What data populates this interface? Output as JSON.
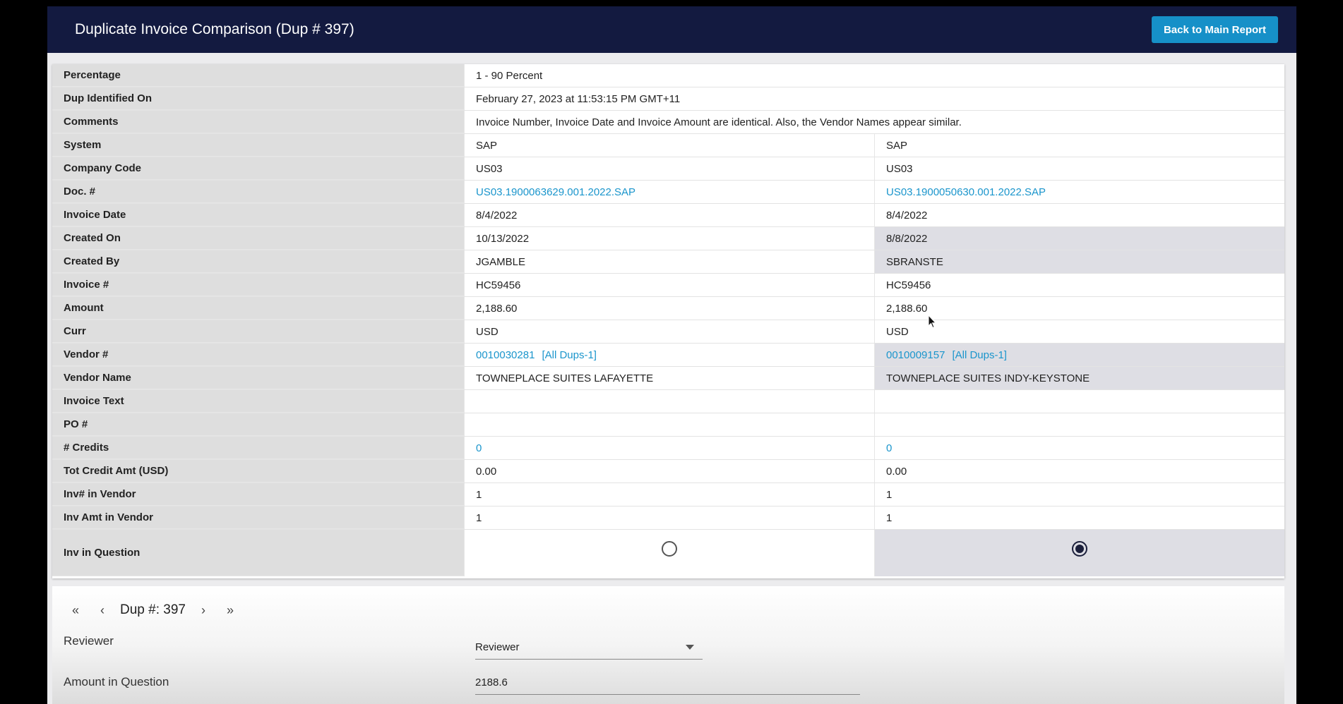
{
  "header": {
    "title": "Duplicate Invoice Comparison (Dup # 397)",
    "back_label": "Back to Main Report"
  },
  "rows": {
    "percentage": {
      "label": "Percentage",
      "value": "1 - 90 Percent"
    },
    "dup_identified": {
      "label": "Dup Identified On",
      "value": "February 27, 2023 at 11:53:15 PM GMT+11"
    },
    "comments": {
      "label": "Comments",
      "value": "Invoice Number, Invoice Date and Invoice Amount are identical. Also, the Vendor Names appear similar."
    },
    "system": {
      "label": "System",
      "a": "SAP",
      "b": "SAP"
    },
    "company_code": {
      "label": "Company Code",
      "a": "US03",
      "b": "US03"
    },
    "doc_no": {
      "label": "Doc. #",
      "a": "US03.1900063629.001.2022.SAP",
      "b": "US03.1900050630.001.2022.SAP"
    },
    "invoice_date": {
      "label": "Invoice Date",
      "a": "8/4/2022",
      "b": "8/4/2022"
    },
    "created_on": {
      "label": "Created On",
      "a": "10/13/2022",
      "b": "8/8/2022"
    },
    "created_by": {
      "label": "Created By",
      "a": "JGAMBLE",
      "b": "SBRANSTE"
    },
    "invoice_no": {
      "label": "Invoice #",
      "a": "HC59456",
      "b": "HC59456"
    },
    "amount": {
      "label": "Amount",
      "a": "2,188.60",
      "b": "2,188.60"
    },
    "curr": {
      "label": "Curr",
      "a": "USD",
      "b": "USD"
    },
    "vendor_no": {
      "label": "Vendor #",
      "a": "0010030281",
      "a_dups": "[All Dups-1]",
      "b": "0010009157",
      "b_dups": "[All Dups-1]"
    },
    "vendor_name": {
      "label": "Vendor Name",
      "a": "TOWNEPLACE SUITES LAFAYETTE",
      "b": "TOWNEPLACE SUITES INDY-KEYSTONE"
    },
    "invoice_text": {
      "label": "Invoice Text",
      "a": "",
      "b": ""
    },
    "po_no": {
      "label": "PO #",
      "a": "",
      "b": ""
    },
    "credits": {
      "label": "# Credits",
      "a": "0",
      "b": "0"
    },
    "tot_credit": {
      "label": "Tot Credit Amt (USD)",
      "a": "0.00",
      "b": "0.00"
    },
    "inv_in_vendor": {
      "label": "Inv# in Vendor",
      "a": "1",
      "b": "1"
    },
    "inv_amt_vendor": {
      "label": "Inv Amt in Vendor",
      "a": "1",
      "b": "1"
    },
    "inv_in_question": {
      "label": "Inv in Question",
      "a_selected": false,
      "b_selected": true
    }
  },
  "pager": {
    "first": "«",
    "prev": "‹",
    "label": "Dup #: 397",
    "next": "›",
    "last": "»"
  },
  "form": {
    "reviewer_label": "Reviewer",
    "reviewer_value": "Reviewer",
    "amount_label": "Amount in Question",
    "amount_value": "2188.6"
  },
  "colors": {
    "header_bg": "#131a40",
    "accent": "#1690c8",
    "link": "#1a95cc",
    "highlight": "#dedee4"
  }
}
